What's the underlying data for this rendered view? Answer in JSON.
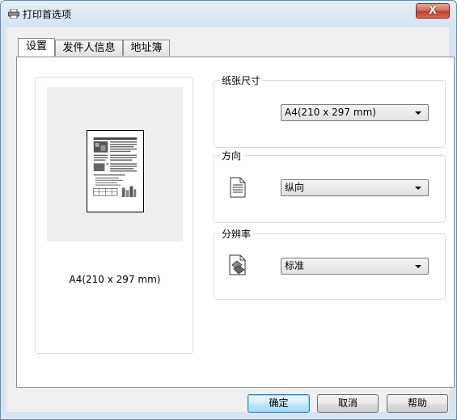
{
  "window": {
    "title": "打印首选项",
    "close_label": "X"
  },
  "tabs": [
    {
      "label": "设置",
      "active": true
    },
    {
      "label": "发件人信息",
      "active": false
    },
    {
      "label": "地址簿",
      "active": false
    }
  ],
  "preview": {
    "caption": "A4(210 x 297 mm)"
  },
  "paper_size": {
    "group_label": "纸张尺寸",
    "selected": "A4(210 x 297 mm)"
  },
  "orientation": {
    "group_label": "方向",
    "selected": "纵向",
    "icon": "portrait-document-icon"
  },
  "resolution": {
    "group_label": "分辨率",
    "selected": "标准",
    "icon": "resolution-icon"
  },
  "buttons": {
    "ok": "确定",
    "cancel": "取消",
    "help": "帮助"
  }
}
